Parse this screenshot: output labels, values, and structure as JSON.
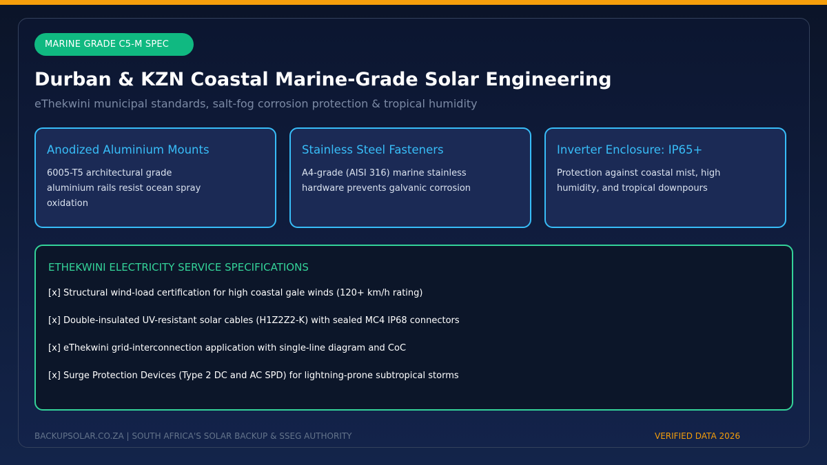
{
  "colors": {
    "accent_orange": "#f59e0b",
    "badge_green": "#10b981",
    "card_border_cyan": "#38bdf8",
    "spec_border_green": "#34d399",
    "background_navy": "#0c1630"
  },
  "badge": {
    "label": "MARINE GRADE C5-M SPEC"
  },
  "header": {
    "title": "Durban & KZN Coastal Marine-Grade Solar Engineering",
    "subtitle": "eThekwini municipal standards, salt-fog corrosion protection & tropical humidity"
  },
  "cards": [
    {
      "title": "Anodized Aluminium Mounts",
      "description": "6005-T5 architectural grade aluminium rails resist ocean spray oxidation"
    },
    {
      "title": "Stainless Steel Fasteners",
      "description": "A4-grade (AISI 316) marine stainless hardware prevents galvanic corrosion"
    },
    {
      "title": "Inverter Enclosure: IP65+",
      "description": "Protection against coastal mist, high humidity, and tropical downpours"
    }
  ],
  "specs": {
    "heading": "ETHEKWINI ELECTRICITY SERVICE SPECIFICATIONS",
    "items": [
      "[x] Structural wind-load certification for high coastal gale winds (120+ km/h rating)",
      "[x] Double-insulated UV-resistant solar cables (H1Z2Z2-K) with sealed MC4 IP68 connectors",
      "[x] eThekwini grid-interconnection application with single-line diagram and CoC",
      "[x] Surge Protection Devices (Type 2 DC and AC SPD) for lightning-prone subtropical storms"
    ]
  },
  "footer": {
    "left": "BACKUPSOLAR.CO.ZA | SOUTH AFRICA'S SOLAR BACKUP & SSEG AUTHORITY",
    "right": "VERIFIED DATA 2026"
  }
}
